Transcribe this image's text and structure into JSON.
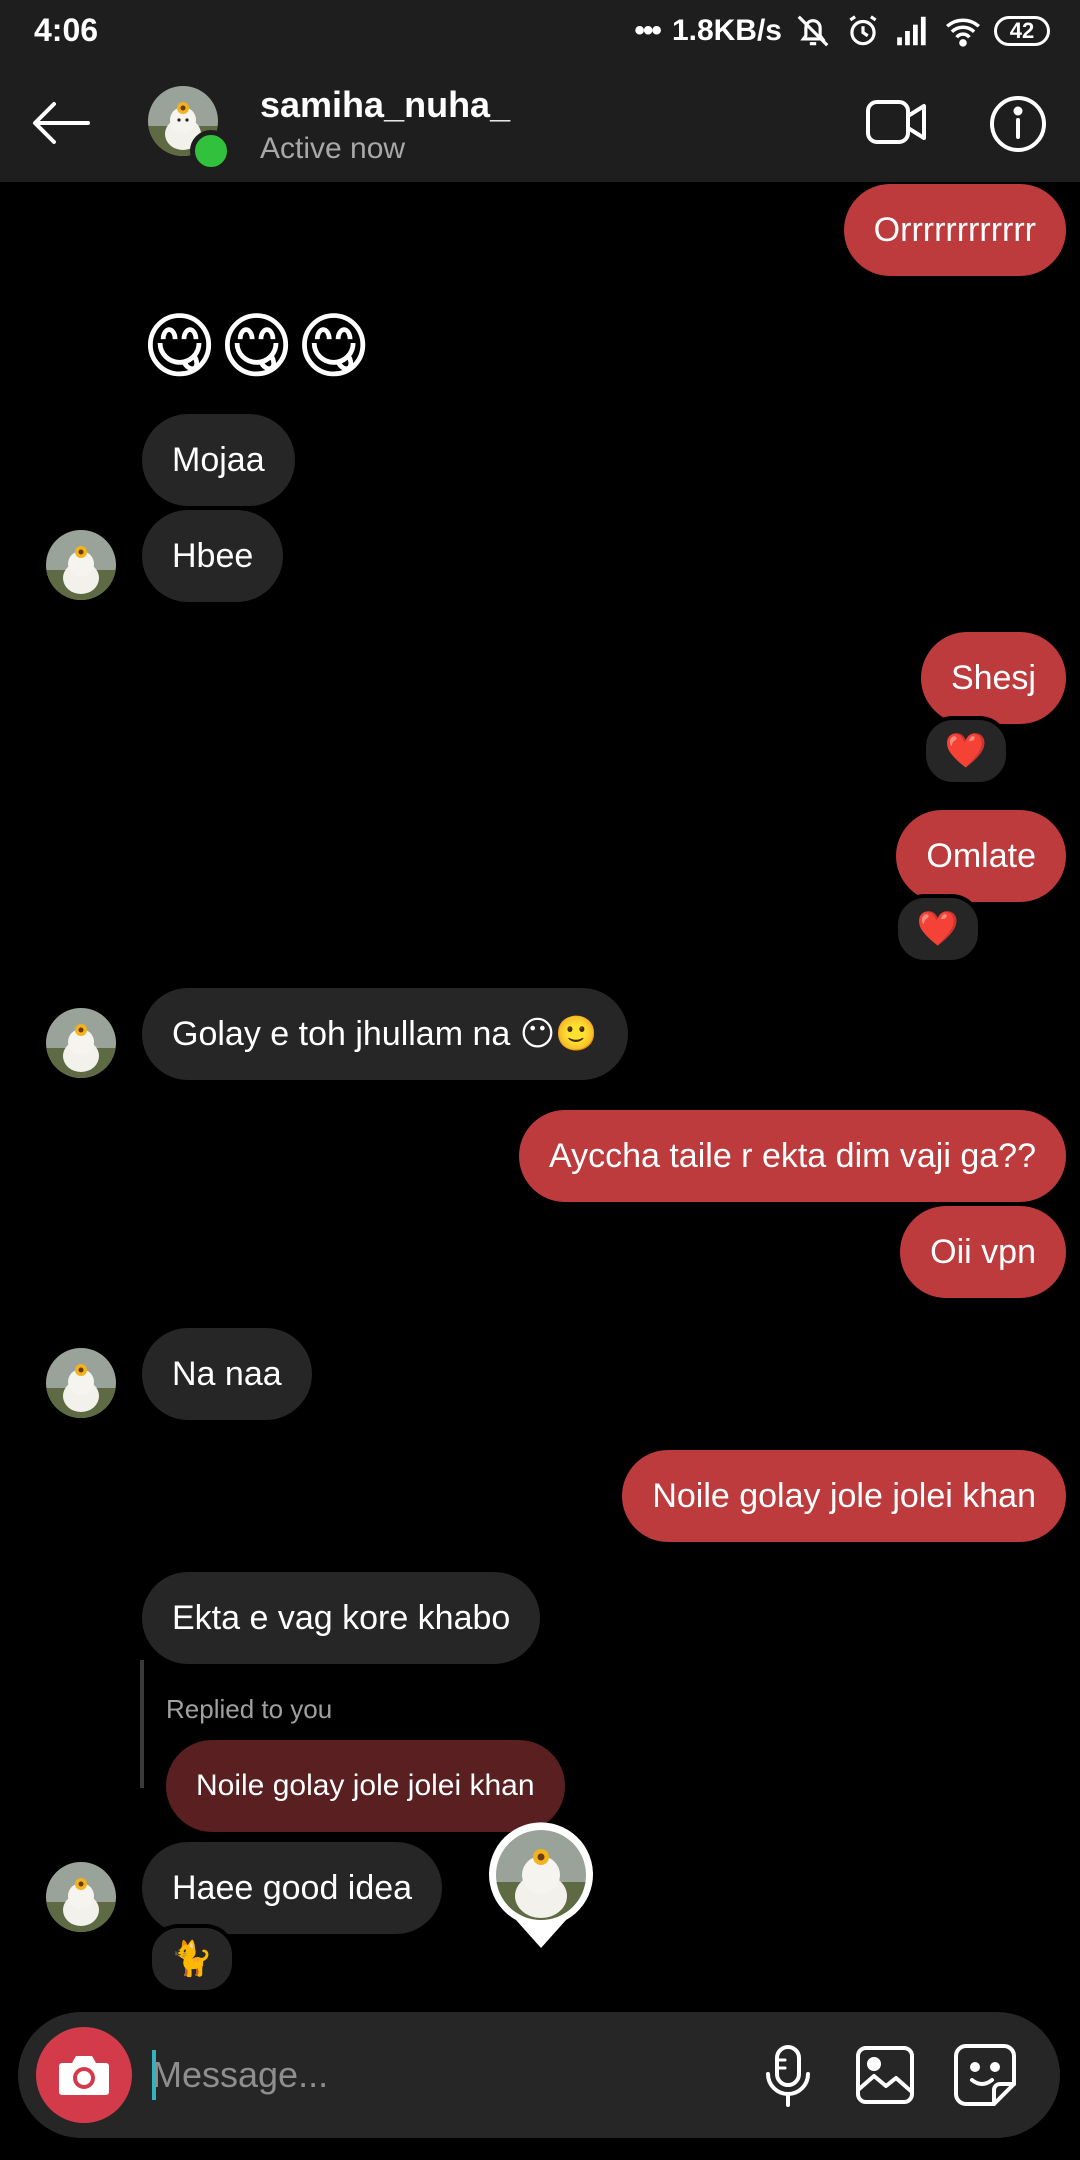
{
  "status_bar": {
    "time": "4:06",
    "network_speed": "1.8KB/s",
    "battery": "42",
    "icons": [
      "dots-icon",
      "mute-icon",
      "alarm-icon",
      "signal-icon",
      "wifi-icon",
      "battery-icon"
    ]
  },
  "header": {
    "username": "samiha_nuha_",
    "status": "Active now",
    "icons": [
      "back-arrow-icon",
      "video-call-icon",
      "info-icon"
    ]
  },
  "messages": [
    {
      "side": "out",
      "text": "Orrrrrrrrrrrr"
    },
    {
      "side": "in",
      "text": "😋😋😋",
      "kind": "emoji"
    },
    {
      "side": "in",
      "text": "Mojaa"
    },
    {
      "side": "in",
      "text": "Hbee"
    },
    {
      "side": "out",
      "text": "Shesj",
      "reaction": "❤️"
    },
    {
      "side": "out",
      "text": "Omlate",
      "reaction": "❤️"
    },
    {
      "side": "in",
      "text": "Golay e toh jhullam na 😶🙂"
    },
    {
      "side": "out",
      "text": "Ayccha taile r ekta dim vaji ga??"
    },
    {
      "side": "out",
      "text": "Oii vpn"
    },
    {
      "side": "in",
      "text": "Na naa"
    },
    {
      "side": "out",
      "text": "Noile golay jole jolei khan"
    },
    {
      "side": "in",
      "text": "Ekta e vag kore khabo"
    },
    {
      "side": "in",
      "text": "Haee good idea",
      "reply_label": "Replied to you",
      "reply_quote": "Noile golay jole jolei khan",
      "reaction": "🐈"
    }
  ],
  "composer": {
    "placeholder": "Message...",
    "icons": [
      "camera-icon",
      "microphone-icon",
      "gallery-icon",
      "sticker-icon"
    ]
  },
  "colors": {
    "outgoing_bubble": "#bd3b3d",
    "incoming_bubble": "#262626",
    "reply_quote": "#5a1f21",
    "online_dot": "#31c13d",
    "camera_button": "#d43b4a"
  }
}
